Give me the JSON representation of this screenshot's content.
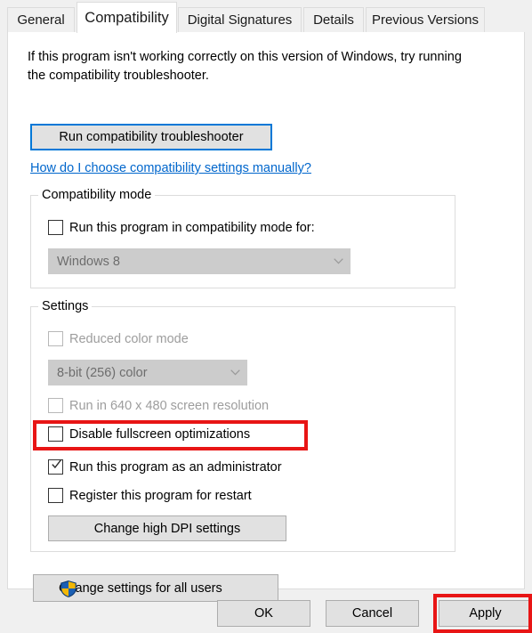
{
  "dialog": {
    "tabs": [
      {
        "label": "General",
        "selected": false
      },
      {
        "label": "Compatibility",
        "selected": true
      },
      {
        "label": "Digital Signatures",
        "selected": false
      },
      {
        "label": "Details",
        "selected": false
      },
      {
        "label": "Previous Versions",
        "selected": false
      }
    ]
  },
  "page": {
    "intro_text": "If this program isn't working correctly on this version of Windows, try running the compatibility troubleshooter.",
    "run_troubleshooter_label": "Run compatibility troubleshooter",
    "help_link_label": "How do I choose compatibility settings manually? "
  },
  "compatibility_mode": {
    "group_title": "Compatibility mode",
    "checkbox_label": "Run this program in compatibility mode for:",
    "checkbox_checked": false,
    "combo_value": "Windows 8",
    "combo_disabled": true
  },
  "settings": {
    "group_title": "Settings",
    "reduced_color_mode": {
      "label": "Reduced color mode",
      "checked": false,
      "disabled": true
    },
    "color_depth_combo": {
      "value": "8-bit (256) color",
      "disabled": true
    },
    "run_640x480": {
      "label": "Run in 640 x 480 screen resolution",
      "checked": false,
      "disabled": true
    },
    "disable_fullscreen": {
      "label": "Disable fullscreen optimizations",
      "checked": false,
      "disabled": false
    },
    "run_as_admin": {
      "label": "Run this program as an administrator",
      "checked": true,
      "disabled": false
    },
    "register_restart": {
      "label": "Register this program for restart",
      "checked": false,
      "disabled": false
    },
    "change_dpi_label": "Change high DPI settings"
  },
  "footer": {
    "change_all_users_label": "Change settings for all users",
    "ok_label": "OK",
    "cancel_label": "Cancel",
    "apply_label": "Apply"
  },
  "annotations": {
    "highlight_color": "#e81515",
    "focus_color": "#0078d7",
    "link_color": "#0066cc",
    "targets": [
      "run-this-program-as-an-administrator-checkbox",
      "apply-button"
    ]
  }
}
